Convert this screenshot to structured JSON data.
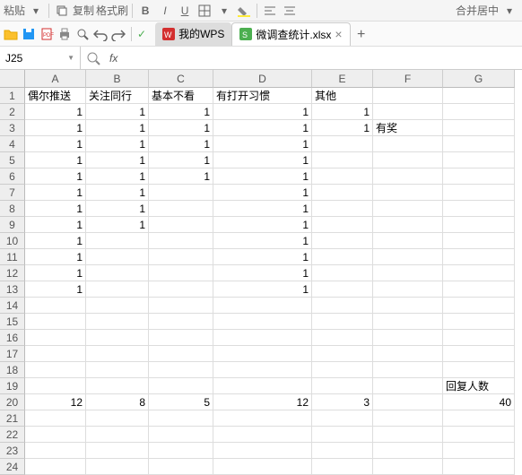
{
  "toolbar_top": {
    "paste_label": "粘贴",
    "copy_label": "复制",
    "format_painter_label": "格式刷",
    "merge_label": "合并居中"
  },
  "tabs": {
    "tab1_label": "我的WPS",
    "tab2_label": "微调查统计.xlsx"
  },
  "cell_ref": "J25",
  "columns": [
    "A",
    "B",
    "C",
    "D",
    "E",
    "F",
    "G"
  ],
  "rows": [
    "1",
    "2",
    "3",
    "4",
    "5",
    "6",
    "7",
    "8",
    "9",
    "10",
    "11",
    "12",
    "13",
    "14",
    "15",
    "16",
    "17",
    "18",
    "19",
    "20",
    "21",
    "22",
    "23",
    "24"
  ],
  "data": {
    "r1": {
      "A": "偶尔推送",
      "B": "关注同行",
      "C": "基本不看",
      "D": "有打开习惯",
      "E": "其他",
      "F": "",
      "G": ""
    },
    "r2": {
      "A": "1",
      "B": "1",
      "C": "1",
      "D": "1",
      "E": "1",
      "F": "",
      "G": ""
    },
    "r3": {
      "A": "1",
      "B": "1",
      "C": "1",
      "D": "1",
      "E": "1",
      "F": "有奖",
      "G": ""
    },
    "r4": {
      "A": "1",
      "B": "1",
      "C": "1",
      "D": "1",
      "E": "",
      "F": "",
      "G": ""
    },
    "r5": {
      "A": "1",
      "B": "1",
      "C": "1",
      "D": "1",
      "E": "",
      "F": "",
      "G": ""
    },
    "r6": {
      "A": "1",
      "B": "1",
      "C": "1",
      "D": "1",
      "E": "",
      "F": "",
      "G": ""
    },
    "r7": {
      "A": "1",
      "B": "1",
      "C": "",
      "D": "1",
      "E": "",
      "F": "",
      "G": ""
    },
    "r8": {
      "A": "1",
      "B": "1",
      "C": "",
      "D": "1",
      "E": "",
      "F": "",
      "G": ""
    },
    "r9": {
      "A": "1",
      "B": "1",
      "C": "",
      "D": "1",
      "E": "",
      "F": "",
      "G": ""
    },
    "r10": {
      "A": "1",
      "B": "",
      "C": "",
      "D": "1",
      "E": "",
      "F": "",
      "G": ""
    },
    "r11": {
      "A": "1",
      "B": "",
      "C": "",
      "D": "1",
      "E": "",
      "F": "",
      "G": ""
    },
    "r12": {
      "A": "1",
      "B": "",
      "C": "",
      "D": "1",
      "E": "",
      "F": "",
      "G": ""
    },
    "r13": {
      "A": "1",
      "B": "",
      "C": "",
      "D": "1",
      "E": "",
      "F": "",
      "G": ""
    },
    "r19": {
      "A": "",
      "B": "",
      "C": "",
      "D": "",
      "E": "",
      "F": "",
      "G": "回复人数"
    },
    "r20": {
      "A": "12",
      "B": "8",
      "C": "5",
      "D": "12",
      "E": "3",
      "F": "",
      "G": "40"
    }
  }
}
